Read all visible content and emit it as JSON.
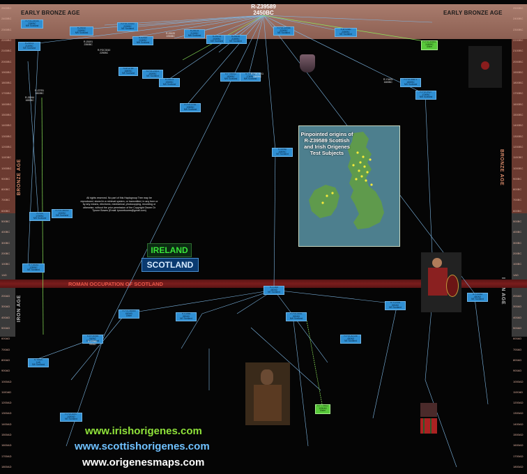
{
  "root": {
    "id": "R-Z39589",
    "date": "2450BC"
  },
  "eras": {
    "early_bronze_left": "EARLY BRONZE AGE",
    "early_bronze_right": "EARLY BRONZE AGE",
    "bronze_left": "BRONZE AGE",
    "bronze_right": "BRONZE AGE",
    "iron_left": "IRON AGE",
    "iron_right": "IRON AGE",
    "roman": "ROMAN OCCUPATION OF SCOTLAND"
  },
  "timeline_left": [
    "2500BC",
    "2400BC",
    "2300BC",
    "2200BC",
    "2100BC",
    "2000BC",
    "1900BC",
    "1800BC",
    "1700BC",
    "1600BC",
    "1500BC",
    "1400BC",
    "1300BC",
    "1200BC",
    "1100BC",
    "1000BC",
    "900BC",
    "800BC",
    "700BC",
    "600BC",
    "500BC",
    "400BC",
    "300BC",
    "200BC",
    "100BC",
    "1AD",
    "100AD",
    "200AD",
    "300AD",
    "400AD",
    "500AD",
    "600AD",
    "700AD",
    "800AD",
    "900AD",
    "1000AD",
    "1100AD",
    "1200AD",
    "1300AD",
    "1400AD",
    "1500AD",
    "1600AD",
    "1700AD",
    "1800AD"
  ],
  "timeline_right": [
    "2500BC",
    "2400BC",
    "2300BC",
    "2200BC",
    "2100BC",
    "2000BC",
    "1900BC",
    "1800BC",
    "1700BC",
    "1600BC",
    "1500BC",
    "1400BC",
    "1300BC",
    "1200BC",
    "1100BC",
    "1000BC",
    "900BC",
    "800BC",
    "700BC",
    "600BC",
    "500BC",
    "400BC",
    "300BC",
    "200BC",
    "100BC",
    "1AD",
    "100AD",
    "200AD",
    "300AD",
    "400AD",
    "500AD",
    "600AD",
    "700AD",
    "800AD",
    "900AD",
    "1000AD",
    "1100AD",
    "1200AD",
    "1300AD",
    "1400AD",
    "1500AD",
    "1600AD",
    "1700AD",
    "1800AD"
  ],
  "map": {
    "title": "Pinpointed origins of R-Z39589 Scottish and Irish Origenes Test Subjects"
  },
  "badges": {
    "ireland": "IRELAND",
    "scotland": "SCOTLAND"
  },
  "copyright": "All rights reserved. No part of this Haplogroup Tree may be reproduced, stored in a retrieval system, or transmitted, in any form or by any means, electronic, mechanical, photocopying, recording or otherwise, without the prior permission of the Copyright Owner Dr Tyrone Bowes (Email: tyronebowes@gmail.com)",
  "urls": [
    "www.irishorigenes.com",
    "www.scottishorigenes.com",
    "www.origenesmaps.com"
  ],
  "colors": {
    "box": "#2f8fd3",
    "box_green": "#58c93a",
    "line": "#7fb9e6",
    "green_line": "#8ee85a",
    "roman": "#7a1d1d",
    "era_band": "#b98b78"
  },
  "nodes": [
    {
      "id": "R-FGC25006",
      "sub": "2350BC",
      "loc": "NW Scotland"
    },
    {
      "id": "R-Z5974",
      "sub": "2100BC",
      "loc": "SW Scotland"
    },
    {
      "id": "R-Z6142",
      "sub": "2300BC",
      "loc": "NW Scotland"
    },
    {
      "id": "R-Z6086",
      "sub": "2050BC",
      "loc": "NW Scotland"
    },
    {
      "id": "R-FGC31400",
      "sub": "2200BC",
      "loc": "NE Scotland"
    },
    {
      "id": "R-S2520",
      "sub": "2150BC",
      "loc": "NW Scotland"
    },
    {
      "id": "R-Z6124",
      "sub": "2100BC",
      "loc": "NW Scotland"
    },
    {
      "id": "R-Z6123",
      "sub": "2000BC",
      "loc": "SW Scotland"
    },
    {
      "id": "R-Z6100",
      "sub": "2150BC",
      "loc": "NE Scotland"
    },
    {
      "id": "R-FGC15986",
      "sub": "2200BC",
      "loc": "NE Scotland"
    },
    {
      "id": "R-BY3480",
      "sub": "2050BC",
      "loc": "NE Scotland"
    },
    {
      "id": "R-FGC26941",
      "sub": "2150BC",
      "loc": "NW Scotland"
    },
    {
      "id": "R-FGC29955",
      "sub": "2000BC",
      "loc": "NW Scotland"
    },
    {
      "id": "R-FGC44861",
      "sub": "2450BC",
      "loc": "Ulster"
    },
    {
      "id": "R-Z6121",
      "sub": "1900BC",
      "loc": "NW Scotland"
    },
    {
      "id": "R-FGC3781",
      "sub": "1950BC",
      "loc": "NW Scotland"
    },
    {
      "id": "R-FT56512",
      "sub": "1800BC",
      "loc": "NW Scotland"
    },
    {
      "id": "R-Y19416",
      "sub": "1750BC",
      "loc": "NW Scotland"
    },
    {
      "id": "R-BY3765",
      "sub": "1850BC",
      "loc": "SW Scotland"
    },
    {
      "id": "R-FGC21611",
      "sub": "1900BC",
      "loc": "NE Scotland"
    },
    {
      "id": "R-FGC54871",
      "sub": "1800BC",
      "loc": "NW Scotland"
    },
    {
      "id": "R-FGC9427",
      "sub": "1700BC",
      "loc": "NW Scotland"
    },
    {
      "id": "R-S5982",
      "sub": "1550BC",
      "loc": "NE Scotland"
    },
    {
      "id": "R-Y16181",
      "sub": "1250BC",
      "loc": "NE Scotland"
    },
    {
      "id": "R-Y23",
      "sub": "1700BC",
      "loc": "NW Scotland"
    },
    {
      "id": "R-FGC56540",
      "sub": "1000BC",
      "loc": "SW Scotland"
    },
    {
      "id": "R-BY36466",
      "sub": "900BC",
      "loc": "SW Scotland"
    },
    {
      "id": "R-Y6820",
      "sub": "1AD",
      "loc": "SW Scotland"
    },
    {
      "id": "R-L1065",
      "sub": "450AD",
      "loc": "NE Scotland"
    },
    {
      "id": "R-FGC56865",
      "sub": "600AD",
      "loc": "Ulster"
    },
    {
      "id": "R-S1685",
      "sub": "550AD",
      "loc": "NE Scotland"
    },
    {
      "id": "R-FGC4061",
      "sub": "500AD",
      "loc": "NW Scotland"
    },
    {
      "id": "R-FGC42146",
      "sub": "450AD",
      "loc": "NE Scotland"
    },
    {
      "id": "R-Y12034",
      "sub": "500AD",
      "loc": "NE Scotland"
    },
    {
      "id": "R-FT78612",
      "sub": "1200AD",
      "loc": "Ulster"
    },
    {
      "id": "R-FGC6597",
      "sub": "1400AD",
      "loc": "NE Scotland"
    },
    {
      "id": "R-Y14483",
      "sub": "450AD",
      "loc": "NE Scotland"
    }
  ],
  "extra_labels": [
    {
      "id": "R-Z6191",
      "sub": "2350BC"
    },
    {
      "id": "R-Z6120",
      "sub": "2250BC"
    },
    {
      "id": "R-Z2781",
      "sub": "1800BC"
    },
    {
      "id": "R-Z6064",
      "sub": "1650BC"
    },
    {
      "id": "R-FGC3010",
      "sub": "2250BC"
    },
    {
      "id": "R-Y4401",
      "sub": "1600BC"
    },
    {
      "id": "R-FGC4211",
      "sub": "1800BC"
    },
    {
      "id": "R-Z2980",
      "sub": "750AD"
    }
  ]
}
